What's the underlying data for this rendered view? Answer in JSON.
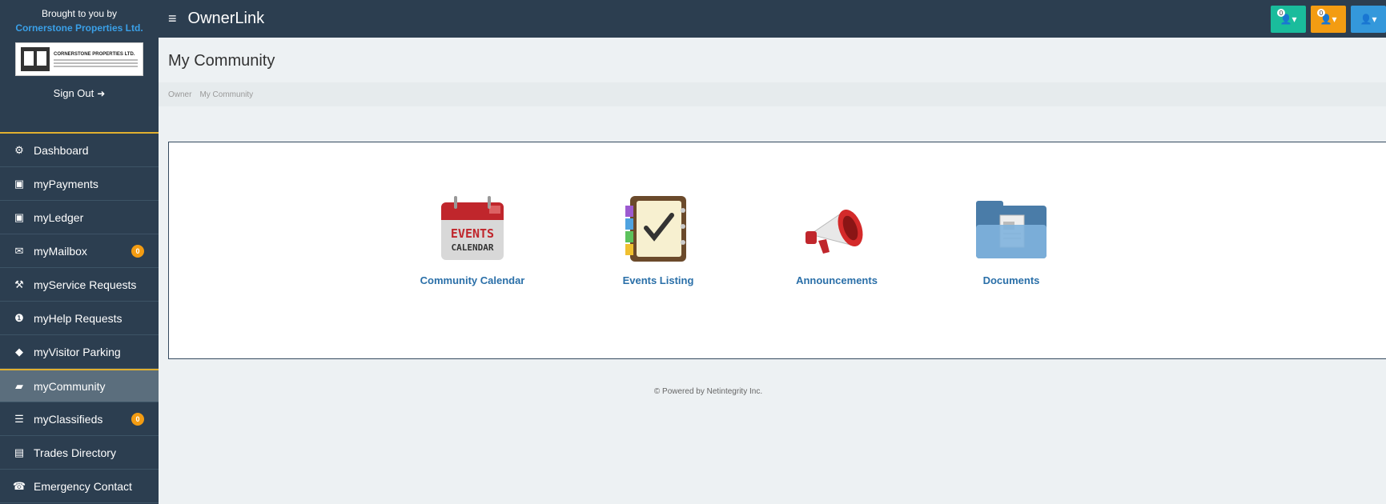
{
  "brand": {
    "brought_by": "Brought to you by",
    "company": "Cornerstone Properties Ltd.",
    "logo_text": "CORNERSTONE PROPERTIES LTD.",
    "sign_out": "Sign Out"
  },
  "nav": {
    "items": [
      {
        "label": "Dashboard",
        "icon": "dashboard-icon",
        "glyph": "⚙"
      },
      {
        "label": "myPayments",
        "icon": "money-icon",
        "glyph": "▣"
      },
      {
        "label": "myLedger",
        "icon": "money-icon",
        "glyph": "▣"
      },
      {
        "label": "myMailbox",
        "icon": "envelope-icon",
        "glyph": "✉",
        "badge": "0"
      },
      {
        "label": "myService Requests",
        "icon": "wrench-icon",
        "glyph": "⚒"
      },
      {
        "label": "myHelp Requests",
        "icon": "info-icon",
        "glyph": "❶"
      },
      {
        "label": "myVisitor Parking",
        "icon": "tag-icon",
        "glyph": "◆"
      },
      {
        "label": "myCommunity",
        "icon": "book-icon",
        "glyph": "▰",
        "active": true
      },
      {
        "label": "myClassifieds",
        "icon": "list-icon",
        "glyph": "☰",
        "badge": "0"
      },
      {
        "label": "Trades Directory",
        "icon": "book-icon",
        "glyph": "▤"
      },
      {
        "label": "Emergency Contact",
        "icon": "phone-icon",
        "glyph": "☎"
      }
    ]
  },
  "topbar": {
    "menu_glyph": "≡",
    "title": "OwnerLink",
    "buttons": [
      {
        "count": "0",
        "color": "#1abc9c"
      },
      {
        "count": "0",
        "color": "#f39c12"
      },
      {
        "count": "",
        "color": "#3498db"
      }
    ]
  },
  "main": {
    "page_title": "My Community",
    "breadcrumb": [
      "Owner",
      "My Community"
    ],
    "tiles": [
      {
        "label": "Community Calendar",
        "icon": "events-calendar-icon",
        "icon_text_1": "EVENTS",
        "icon_text_2": "CALENDAR"
      },
      {
        "label": "Events Listing",
        "icon": "checklist-notebook-icon"
      },
      {
        "label": "Announcements",
        "icon": "megaphone-icon"
      },
      {
        "label": "Documents",
        "icon": "folder-document-icon"
      }
    ],
    "footer": "© Powered by Netintegrity Inc."
  },
  "colors": {
    "sidebar_bg": "#2c3e50",
    "accent": "#e0b030",
    "link": "#2a6fa8",
    "badge": "#f39c12"
  }
}
